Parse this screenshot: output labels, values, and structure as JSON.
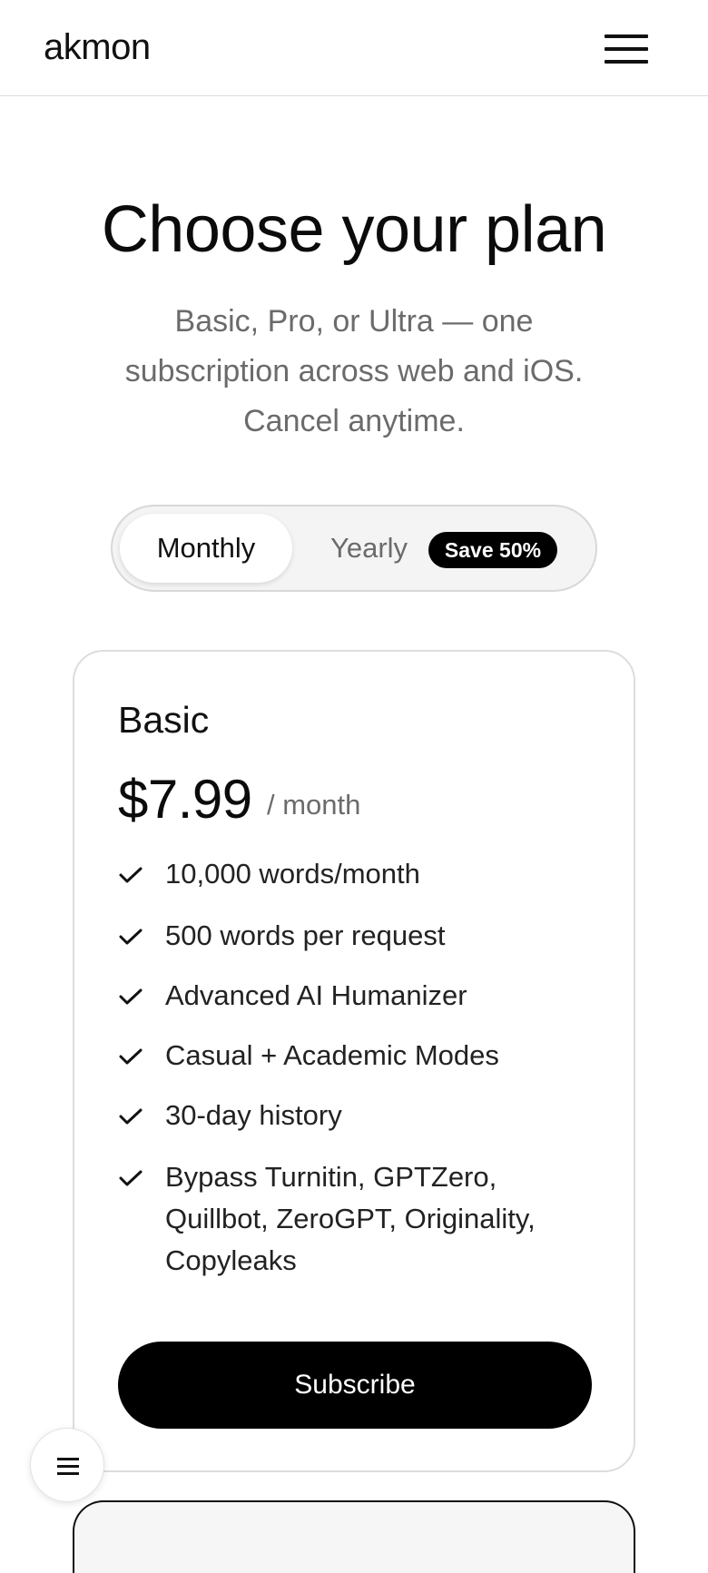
{
  "header": {
    "logo": "akmon",
    "menu_icon": "hamburger-menu-icon"
  },
  "hero": {
    "title": "Choose your plan",
    "subtitle": "Basic, Pro, or Ultra — one subscription across web and iOS. Cancel anytime."
  },
  "billing_toggle": {
    "monthly_label": "Monthly",
    "yearly_label": "Yearly",
    "save_badge": "Save 50%",
    "selected": "Monthly"
  },
  "plan": {
    "name": "Basic",
    "price": "$7.99",
    "period": "/ month",
    "features": [
      "10,000 words/month",
      "500 words per request",
      "Advanced AI Humanizer",
      "Casual + Academic Modes",
      "30-day history",
      "Bypass Turnitin, GPTZero, Quillbot, ZeroGPT, Originality, Copyleaks"
    ],
    "subscribe_label": "Subscribe"
  },
  "fab": {
    "icon": "list-menu-icon"
  },
  "colors": {
    "accent": "#000000",
    "muted_text": "#6b6b6b",
    "border": "#dddddd",
    "toggle_bg": "#f4f4f4"
  }
}
